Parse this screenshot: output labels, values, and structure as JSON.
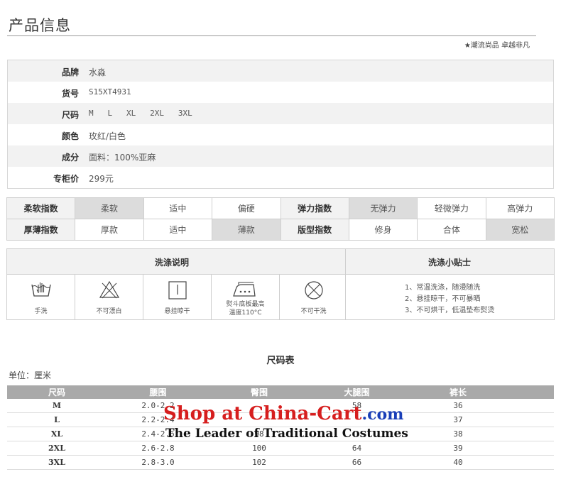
{
  "header": {
    "title": "产品信息",
    "slogan": "★潮流尚品 卓越非凡"
  },
  "info": [
    {
      "label": "品牌",
      "value": "水淼"
    },
    {
      "label": "货号",
      "value": "S15XT4931"
    },
    {
      "label": "尺码",
      "value": "M   L   XL   2XL   3XL"
    },
    {
      "label": "颜色",
      "value": "玫红/白色"
    },
    {
      "label": "成分",
      "value": "面料：100%亚麻"
    },
    {
      "label": "专柜价",
      "value": "299元"
    }
  ],
  "indices": {
    "softness": {
      "label": "柔软指数",
      "options": [
        "柔软",
        "适中",
        "偏硬"
      ],
      "selected": 0
    },
    "elasticity": {
      "label": "弹力指数",
      "options": [
        "无弹力",
        "轻微弹力",
        "高弹力"
      ],
      "selected": 0
    },
    "thickness": {
      "label": "厚薄指数",
      "options": [
        "厚款",
        "适中",
        "薄款"
      ],
      "selected": 2
    },
    "fit": {
      "label": "版型指数",
      "options": [
        "修身",
        "合体",
        "宽松"
      ],
      "selected": 2
    }
  },
  "washing": {
    "title": "洗涤说明",
    "tips_title": "洗涤小贴士",
    "items": [
      {
        "icon": "hand-wash-icon",
        "caption": "手洗"
      },
      {
        "icon": "no-bleach-icon",
        "caption": "不可漂白"
      },
      {
        "icon": "hang-dry-icon",
        "caption": "悬挂晾干"
      },
      {
        "icon": "iron-icon",
        "caption": "熨斗底板最高\n温度110°C"
      },
      {
        "icon": "no-dry-clean-icon",
        "caption": "不可干洗"
      }
    ],
    "tips": [
      "1、常温洗涤，随漫随洗",
      "2、悬挂晾干，不可暴晒",
      "3、不可烘干，低温垫布熨烫"
    ]
  },
  "size_chart": {
    "title": "尺码表",
    "unit": "单位：厘米",
    "headers": [
      "尺码",
      "腰围",
      "臀围",
      "大腿围",
      "裤长"
    ],
    "rows": [
      [
        "M",
        "2.0-2.2",
        "",
        "58",
        "36"
      ],
      [
        "L",
        "2.2-2.4",
        "",
        "",
        "37"
      ],
      [
        "XL",
        "2.4-2.6",
        "98",
        "",
        "38"
      ],
      [
        "2XL",
        "2.6-2.8",
        "100",
        "64",
        "39"
      ],
      [
        "3XL",
        "2.8-3.0",
        "102",
        "66",
        "40"
      ]
    ]
  },
  "watermark": {
    "line1a": "Shop at ",
    "line1b": "China-Cart",
    "line1c": ".com",
    "line2": "The Leader of Traditional Costumes"
  },
  "colors": {
    "header_bar": "#a9a9a9",
    "selected_cell": "#dcdcdc",
    "watermark_red": "#d61e1e",
    "watermark_blue": "#1a3fb8"
  }
}
